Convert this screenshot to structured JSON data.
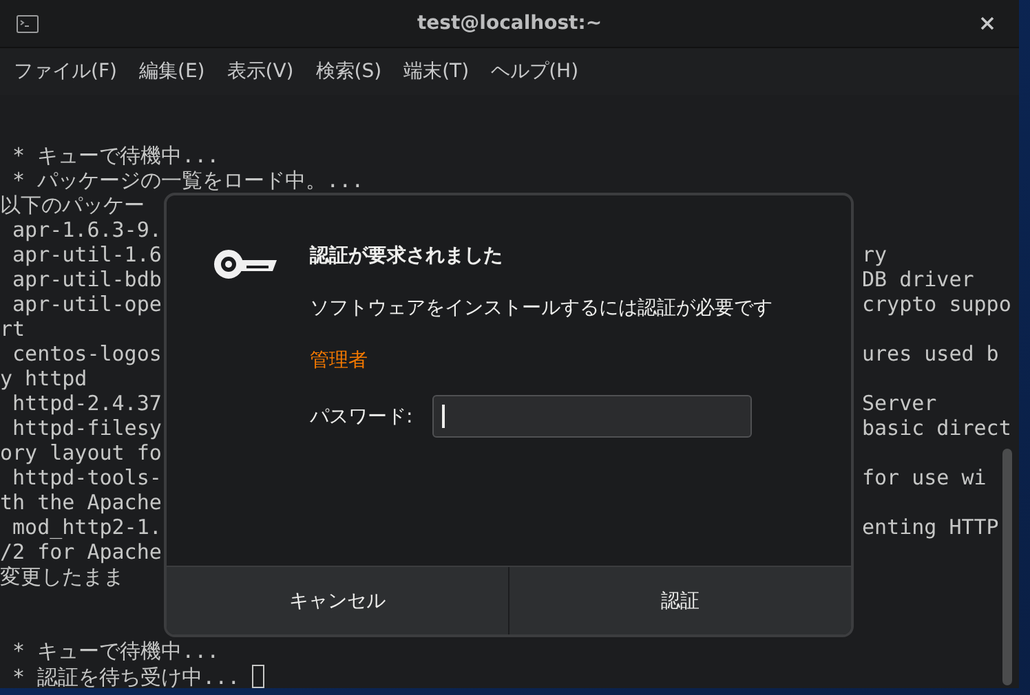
{
  "window": {
    "title": "test@localhost:~"
  },
  "menu": [
    "ファイル(F)",
    "編集(E)",
    "表示(V)",
    "検索(S)",
    "端末(T)",
    "ヘルプ(H)"
  ],
  "terminal": [
    {
      "kind": "blank"
    },
    {
      "kind": "blank"
    },
    {
      "kind": "text",
      "left": " * キューで待機中..."
    },
    {
      "kind": "text",
      "left": " * パッケージの一覧をロード中。..."
    },
    {
      "kind": "text",
      "left": "以下のパッケー"
    },
    {
      "kind": "text",
      "left": " apr-1.6.3-9."
    },
    {
      "kind": "text",
      "left": " apr-util-1.6",
      "right": "ry"
    },
    {
      "kind": "text",
      "left": " apr-util-bdb",
      "right": "DB driver"
    },
    {
      "kind": "text",
      "left": " apr-util-ope",
      "right": "crypto suppo"
    },
    {
      "kind": "text",
      "left": "rt"
    },
    {
      "kind": "text",
      "left": " centos-logos",
      "right": "ures used b"
    },
    {
      "kind": "text",
      "left": "y httpd"
    },
    {
      "kind": "text",
      "left": " httpd-2.4.37",
      "right": "Server"
    },
    {
      "kind": "text",
      "left": " httpd-filesy",
      "right": "basic direct"
    },
    {
      "kind": "text",
      "left": "ory layout fo"
    },
    {
      "kind": "text",
      "left": " httpd-tools-",
      "right": "for use wi"
    },
    {
      "kind": "text",
      "left": "th the Apache"
    },
    {
      "kind": "text",
      "left": " mod_http2-1.",
      "right": "enting HTTP"
    },
    {
      "kind": "text",
      "left": "/2 for Apache"
    },
    {
      "kind": "text",
      "left": "変更したまま"
    },
    {
      "kind": "blank"
    },
    {
      "kind": "blank"
    },
    {
      "kind": "text",
      "left": " * キューで待機中..."
    },
    {
      "kind": "prompt",
      "left": " * 認証を待ち受け中..."
    }
  ],
  "dialog": {
    "title": "認証が要求されました",
    "message": "ソフトウェアをインストールするには認証が必要です",
    "user": "管理者",
    "password_label": "パスワード:",
    "buttons": [
      "キャンセル",
      "認証"
    ]
  }
}
